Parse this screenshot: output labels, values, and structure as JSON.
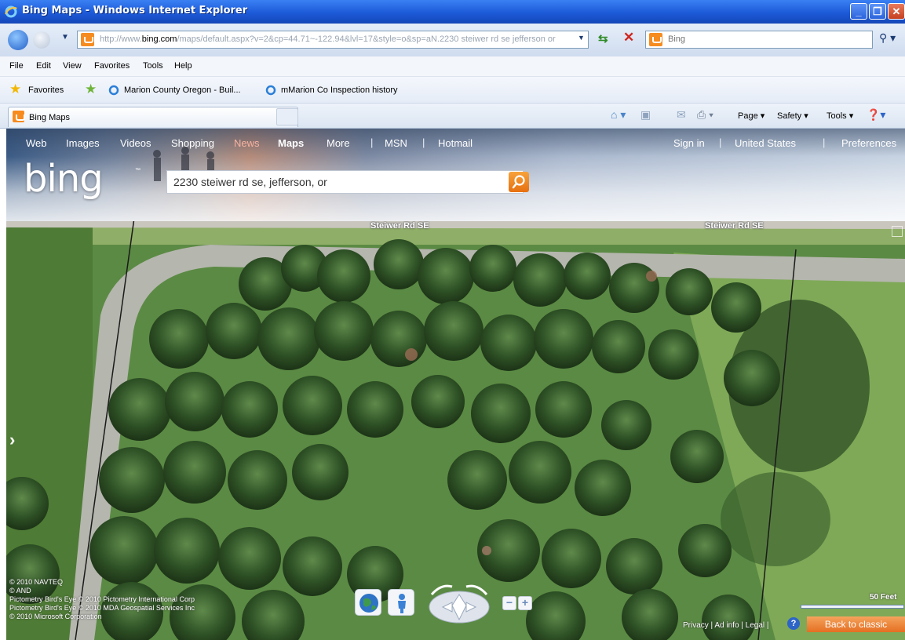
{
  "window": {
    "title": "Bing Maps - Windows Internet Explorer"
  },
  "address": {
    "url_prefix": "http://www.",
    "url_domain": "bing.com",
    "url_rest": "/maps/default.aspx?v=2&cp=44.71~-122.94&lvl=17&style=o&sp=aN.2230 steiwer rd se jefferson or",
    "search_placeholder": "Bing"
  },
  "menu": {
    "items": [
      "File",
      "Edit",
      "View",
      "Favorites",
      "Tools",
      "Help"
    ]
  },
  "favorites": {
    "label": "Favorites",
    "links": [
      "Marion County Oregon - Buil...",
      "mMarion Co Inspection history"
    ]
  },
  "tab": {
    "label": "Bing Maps"
  },
  "commands": {
    "page": "Page ▾",
    "safety": "Safety ▾",
    "tools": "Tools ▾"
  },
  "bing": {
    "nav": [
      "Web",
      "Images",
      "Videos",
      "Shopping",
      "News",
      "Maps",
      "More"
    ],
    "nav_right_links": [
      "MSN",
      "Hotmail"
    ],
    "account": [
      "Sign in",
      "United States",
      "Preferences"
    ],
    "logo": "bing",
    "search_value": "2230 steiwer rd se, jefferson, or"
  },
  "map": {
    "road_labels": [
      "Steiwer Rd SE",
      "Steiwer Rd SE"
    ],
    "copyright_lines": [
      "© 2010 NAVTEQ",
      "© AND",
      "Pictometry Bird's Eye © 2010 Pictometry International Corp",
      "Pictometry Bird's Eye © 2010 MDA Geospatial Services Inc",
      "© 2010 Microsoft Corporation"
    ],
    "scale": "50 Feet",
    "footer": "Privacy | Ad info | Legal |",
    "back_to_classic": "Back to classic"
  },
  "colors": {
    "titlebar": "#1d5ad8",
    "bing_orange": "#e7700f",
    "map_green": "#4d7b3e"
  }
}
